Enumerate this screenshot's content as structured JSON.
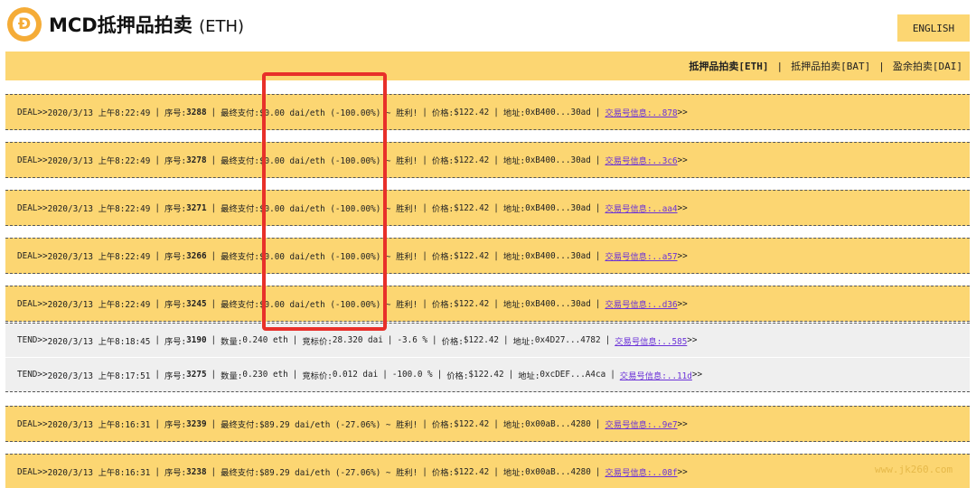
{
  "header": {
    "logo_glyph": "Đ",
    "title_main": "MCD抵押品拍卖",
    "title_sub": "(ETH)",
    "language_button": "ENGLISH"
  },
  "nav": {
    "items": [
      {
        "label": "抵押品拍卖[ETH]",
        "active": true
      },
      {
        "label": "抵押品拍卖[BAT]",
        "active": false
      },
      {
        "label": "盈余拍卖[DAI]",
        "active": false
      }
    ],
    "separator": "|"
  },
  "rows": [
    {
      "type": "DEAL",
      "arrow": ">>",
      "time": "2020/3/13 上午8:22:49",
      "id_label": "序号:",
      "id": "3288",
      "pay_label": "最终支付:",
      "pay_value": "$0.00 dai/eth (-100.00%) ~ 胜利!",
      "price_label": "价格:",
      "price": "$122.42",
      "addr_label": "地址:",
      "address": "0xB400...30ad",
      "tx_link": "交易号信息:..878",
      "tail": ">>"
    },
    {
      "type": "DEAL",
      "arrow": ">>",
      "time": "2020/3/13 上午8:22:49",
      "id_label": "序号:",
      "id": "3278",
      "pay_label": "最终支付:",
      "pay_value": "$0.00 dai/eth (-100.00%) ~ 胜利!",
      "price_label": "价格:",
      "price": "$122.42",
      "addr_label": "地址:",
      "address": "0xB400...30ad",
      "tx_link": "交易号信息:..3c6",
      "tail": ">>"
    },
    {
      "type": "DEAL",
      "arrow": ">>",
      "time": "2020/3/13 上午8:22:49",
      "id_label": "序号:",
      "id": "3271",
      "pay_label": "最终支付:",
      "pay_value": "$0.00 dai/eth (-100.00%) ~ 胜利!",
      "price_label": "价格:",
      "price": "$122.42",
      "addr_label": "地址:",
      "address": "0xB400...30ad",
      "tx_link": "交易号信息:..aa4",
      "tail": ">>"
    },
    {
      "type": "DEAL",
      "arrow": ">>",
      "time": "2020/3/13 上午8:22:49",
      "id_label": "序号:",
      "id": "3266",
      "pay_label": "最终支付:",
      "pay_value": "$0.00 dai/eth (-100.00%) ~ 胜利!",
      "price_label": "价格:",
      "price": "$122.42",
      "addr_label": "地址:",
      "address": "0xB400...30ad",
      "tx_link": "交易号信息:..a57",
      "tail": ">>"
    },
    {
      "type": "DEAL",
      "arrow": ">>",
      "time": "2020/3/13 上午8:22:49",
      "id_label": "序号:",
      "id": "3245",
      "pay_label": "最终支付:",
      "pay_value": "$0.00 dai/eth (-100.00%) ~ 胜利!",
      "price_label": "价格:",
      "price": "$122.42",
      "addr_label": "地址:",
      "address": "0xB400...30ad",
      "tx_link": "交易号信息:..d36",
      "tail": ">>"
    },
    {
      "type": "TEND",
      "arrow": ">>",
      "time": "2020/3/13 上午8:18:45",
      "id_label": "序号:",
      "id": "3190",
      "qty_label": "数量:",
      "qty": "0.240 eth",
      "bid_label": "竞标价:",
      "bid": "28.320 dai",
      "pct": "-3.6 %",
      "price_label": "价格:",
      "price": "$122.42",
      "addr_label": "地址:",
      "address": "0x4D27...4782",
      "tx_link": "交易号信息:..585",
      "tail": ">>"
    },
    {
      "type": "TEND",
      "arrow": ">>",
      "time": "2020/3/13 上午8:17:51",
      "id_label": "序号:",
      "id": "3275",
      "qty_label": "数量:",
      "qty": "0.230 eth",
      "bid_label": "竞标价:",
      "bid": "0.012 dai",
      "pct": "-100.0 %",
      "price_label": "价格:",
      "price": "$122.42",
      "addr_label": "地址:",
      "address": "0xcDEF...A4ca",
      "tx_link": "交易号信息:..11d",
      "tail": ">>"
    },
    {
      "type": "DEAL",
      "arrow": ">>",
      "time": "2020/3/13 上午8:16:31",
      "id_label": "序号:",
      "id": "3239",
      "pay_label": "最终支付:",
      "pay_value": "$89.29 dai/eth (-27.06%) ~ 胜利!",
      "price_label": "价格:",
      "price": "$122.42",
      "addr_label": "地址:",
      "address": "0x00aB...4280",
      "tx_link": "交易号信息:..9e7",
      "tail": ">>"
    },
    {
      "type": "DEAL",
      "arrow": ">>",
      "time": "2020/3/13 上午8:16:31",
      "id_label": "序号:",
      "id": "3238",
      "pay_label": "最终支付:",
      "pay_value": "$89.29 dai/eth (-27.06%) ~ 胜利!",
      "price_label": "价格:",
      "price": "$122.42",
      "addr_label": "地址:",
      "address": "0x00aB...4280",
      "tx_link": "交易号信息:..08f",
      "tail": ">>"
    }
  ],
  "watermark": "www.jk260.com",
  "colors": {
    "deal_row": "#fcd672",
    "tend_row": "#efefef",
    "link": "#6b32d8",
    "highlight_box": "#e8302a",
    "logo": "#f5ac37"
  }
}
